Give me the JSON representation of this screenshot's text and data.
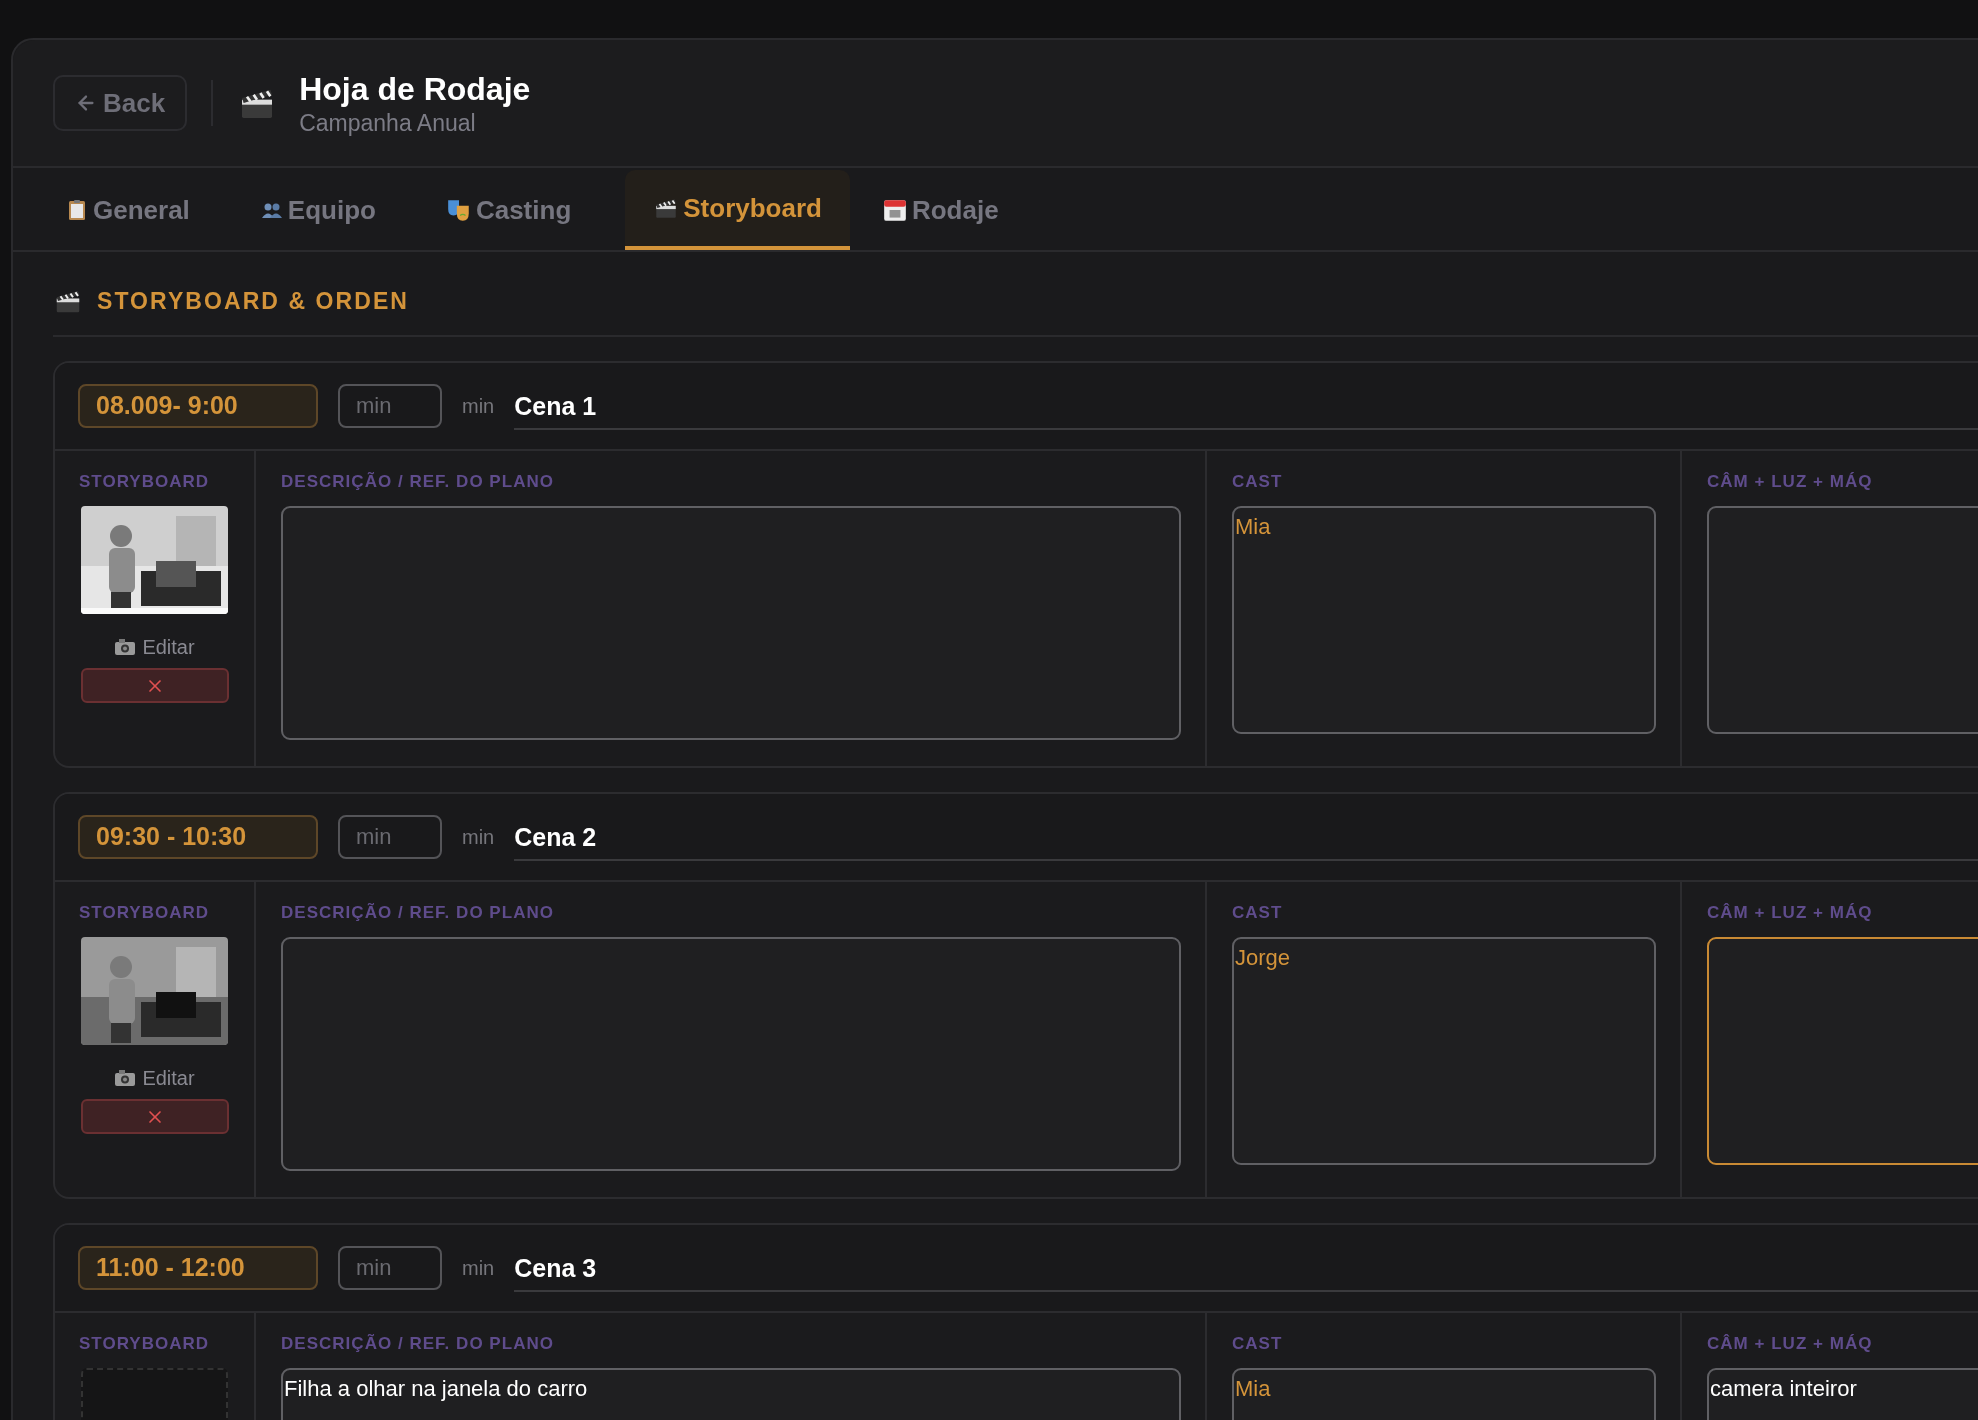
{
  "header": {
    "back_label": "Back",
    "title": "Hoja de Rodaje",
    "subtitle": "Campanha Anual"
  },
  "tabs": [
    {
      "label": "General",
      "selected": false
    },
    {
      "label": "Equipo",
      "selected": false
    },
    {
      "label": "Casting",
      "selected": false
    },
    {
      "label": "Storyboard",
      "selected": true
    },
    {
      "label": "Rodaje",
      "selected": false
    }
  ],
  "section": {
    "title": "STORYBOARD & ORDEN"
  },
  "scenes": [
    {
      "time": "08.009- 9:00",
      "duration_placeholder": "min",
      "unit": "min",
      "title": "Cena 1",
      "labels": [
        "STORYBOARD",
        "DESCRIÇÃO / REF. DO PLANO",
        "CAST",
        "CÂM + LUZ + MÁQ"
      ],
      "image": {
        "kind": "picture"
      },
      "edit_label": "Editar",
      "cast": "Mia",
      "camera_focused": false
    },
    {
      "time": "09:30 - 10:30",
      "duration_placeholder": "min",
      "unit": "min",
      "title": "Cena 2",
      "labels": [
        "STORYBOARD",
        "DESCRIÇÃO / REF. DO PLANO",
        "CAST",
        "CÂM + LUZ + MÁQ"
      ],
      "image": {
        "kind": "picture"
      },
      "edit_label": "Editar",
      "cast": "Jorge",
      "camera_focused": true
    },
    {
      "time": "11:00 - 12:00",
      "duration_placeholder": "min",
      "unit": "min",
      "title": "Cena 3",
      "labels": [
        "STORYBOARD",
        "DESCRIÇÃO / REF. DO PLANO",
        "CAST",
        "CÂM + LUZ + MÁQ"
      ],
      "description": "Filha a olhar na janela do carro",
      "cast": "Mia",
      "camera": "camera inteiror",
      "camera_focused": false
    }
  ]
}
